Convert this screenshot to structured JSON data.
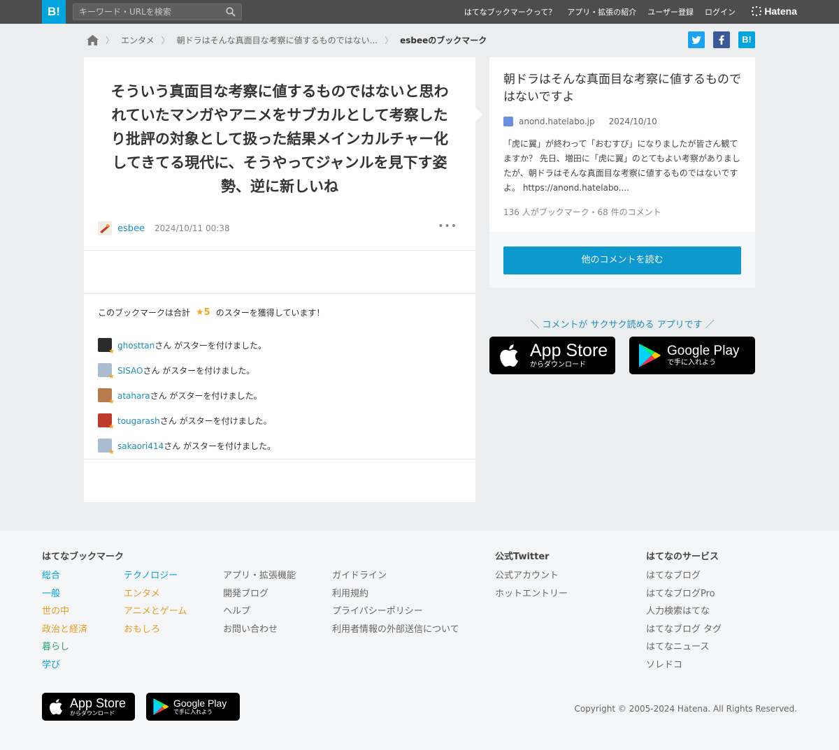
{
  "header": {
    "logo": "B!",
    "search_placeholder": "キーワード・URLを検索",
    "nav": [
      "はてなブックマークって？",
      "アプリ・拡張の紹介",
      "ユーザー登録",
      "ログイン"
    ],
    "brand": "Hatena"
  },
  "breadcrumb": {
    "items": [
      "エンタメ",
      "朝ドラはそんな真面目な考察に値するものではない...",
      "esbeeのブックマーク"
    ]
  },
  "share": {
    "twitter": "t",
    "facebook": "f",
    "hatena": "B!"
  },
  "bookmark": {
    "comment": "そういう真面目な考察に値するものではないと思われていたマンガやアニメをサブカルとして考察したり批評の対象として扱った結果メインカルチャー化してきてる現代に、そうやってジャンルを見下す姿勢、逆に新しいね",
    "user": "esbee",
    "date": "2024/10/11 00:38",
    "more": "•••"
  },
  "stars": {
    "prefix": "このブックマークは合計",
    "count": "★5",
    "suffix": "のスターを獲得しています！",
    "suffix_user": "さん がスターを付けました。",
    "users": [
      {
        "name": "ghosttan",
        "avatar_color": "#2b2b2b"
      },
      {
        "name": "SISAO",
        "avatar_color": "#a9bcd0"
      },
      {
        "name": "atahara",
        "avatar_color": "#b57a4e"
      },
      {
        "name": "tougarash",
        "avatar_color": "#c0392b"
      },
      {
        "name": "sakaori414",
        "avatar_color": "#a9bcd0"
      }
    ]
  },
  "entry": {
    "title": "朝ドラはそんな真面目な考察に値するものではないですよ",
    "site": "anond.hatelabo.jp",
    "date": "2024/10/10",
    "description": "「虎に翼」が終わって「おむすび」になりましたが皆さん観てますか？ 先日、増田に「虎に翼」のとてもよい考察がありましたが、朝ドラはそんな真面目な考察に値するものではないですよ。 https://anond.hatelabo....",
    "count_text": "136 人がブックマーク・68 件のコメント",
    "read_button": "他のコメントを読む"
  },
  "promo": {
    "text": "＼ コメントが サクサク読める アプリです ／",
    "appstore_big": "App Store",
    "appstore_small": "からダウンロード",
    "googleplay_big": "Google Play",
    "googleplay_small": "で手に入れよう"
  },
  "footer": {
    "heading_bookmark": "はてなブックマーク",
    "col1": [
      "総合",
      "一般",
      "世の中",
      "政治と経済",
      "暮らし",
      "学び"
    ],
    "col2": [
      "テクノロジー",
      "エンタメ",
      "アニメとゲーム",
      "おもしろ"
    ],
    "col3": [
      "アプリ・拡張機能",
      "開発ブログ",
      "ヘルプ",
      "お問い合わせ"
    ],
    "col4": [
      "ガイドライン",
      "利用規約",
      "プライバシーポリシー",
      "利用者情報の外部送信について"
    ],
    "heading_twitter": "公式Twitter",
    "twitter_links": [
      "公式アカウント",
      "ホットエントリー"
    ],
    "heading_services": "はてなのサービス",
    "services": [
      "はてなブログ",
      "はてなブログPro",
      "人力検索はてな",
      "はてなブログ タグ",
      "はてなニュース",
      "ソレドコ"
    ],
    "copyright": "Copyright © 2005-2024 Hatena. All Rights Reserved."
  }
}
